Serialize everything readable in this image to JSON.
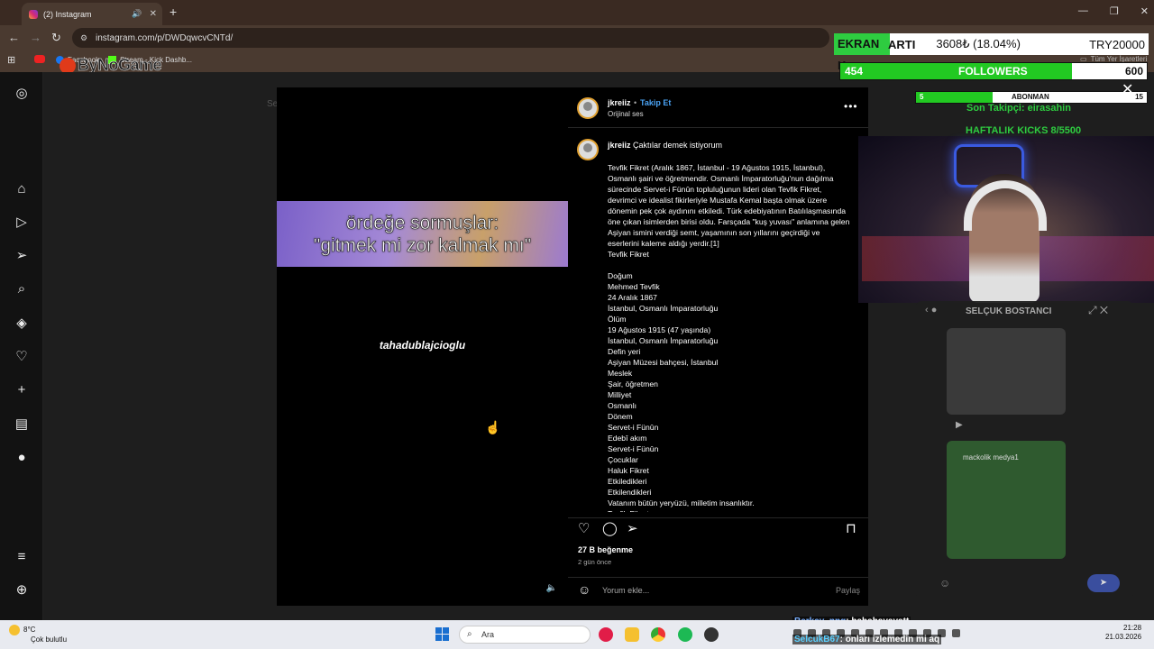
{
  "browser": {
    "tab_title": "(2) Instagram",
    "url": "instagram.com/p/DWDqwcvCNTd/",
    "bookmarks": [
      "Facebook",
      "Stream - Kick Dashb...",
      "Tüm Yer İşaretleri"
    ]
  },
  "overlay_logo": "ByNoGame",
  "sidebar_faded_text": "Se",
  "post": {
    "video_caption_line1": "ördeğe sormuşlar:",
    "video_caption_line2": "\"gitmek mi zor kalmak mı\"",
    "watermark": "tahadublajcioglu",
    "username": "jkreiiz",
    "follow_label": "Takip Et",
    "separator": "•",
    "audio_label": "Orijinal ses",
    "more_icon": "more-horizontal-icon",
    "caption_title": "Çaktılar demek istiyorum",
    "caption_body": "Tevfik Fikret (Aralık 1867, İstanbul - 19 Ağustos 1915, İstanbul), Osmanlı şairi ve öğretmendir. Osmanlı İmparatorluğu'nun dağılma sürecinde Servet-i Fünûn topluluğunun lideri olan Tevfik Fikret, devrimci ve idealist fikirleriyle Mustafa Kemal başta olmak üzere dönemin pek çok aydınını etkiledi. Türk edebiyatının Batılılaşmasında öne çıkan isimlerden birisi oldu. Farsçada \"kuş yuvası\" anlamına gelen Aşiyan ismini verdiği semt, yaşamının son yıllarını geçirdiği ve eserlerini kaleme aldığı yerdir.[1]\nTevfik Fikret\n\nDoğum\nMehmed Tevfik\n24 Aralık 1867\nİstanbul, Osmanlı İmparatorluğu\nÖlüm\n19 Ağustos 1915 (47 yaşında)\nİstanbul, Osmanlı İmparatorluğu\nDefin yeri\nAşiyan Müzesi bahçesi, İstanbul\nMeslek\nŞair, öğretmen\nMilliyet\nOsmanlı\nDönem\nServet-i Fünûn\nEdebî akım\nServet-i Fünûn\nÇocuklar\nHaluk Fikret\nEtkiledikleri\nEtkilendikleri\nVatanım bütün yeryüzü, milletim insanlıktır.\nTevfik Fikret",
    "likes": "27 B beğenme",
    "time_ago": "2 gün önce",
    "comment_placeholder": "Yorum ekle...",
    "share_label": "Paylaş"
  },
  "stream": {
    "gpu_label_a": "EKRAN K",
    "gpu_label_b": "ARTI",
    "gpu_price": "3608₺ (18.04%)",
    "gpu_target": "TRY20000",
    "followers_current": "454",
    "followers_label": "FOLLOWERS",
    "followers_goal": "600",
    "followers_progress": 0.757,
    "subs_current": "5",
    "subs_label": "ABONMAN",
    "subs_goal": "15",
    "subs_progress": 0.333,
    "last_follower": "Son Takipçi: eirasahin",
    "weekly_kicks": "HAFTALIK KICKS 8/5500",
    "chat_window_title": "SELÇUK BOSTANCI",
    "chat_image_label": "mackolik medya1",
    "chat_lines": [
      {
        "user": "Berkay_nng",
        "text": ": hahahayayatt"
      },
      {
        "user": "SelcukB67",
        "text": ": onları izlemedin mi aq"
      }
    ]
  },
  "taskbar": {
    "weather_temp": "8°C",
    "weather_desc": "Çok bulutlu",
    "search_placeholder": "Ara",
    "time": "21:28",
    "date": "21.03.2026"
  },
  "colors": {
    "accent_green": "#22c922",
    "follow_blue": "#4aa3f5",
    "chrome_brown": "#4a3a30"
  }
}
